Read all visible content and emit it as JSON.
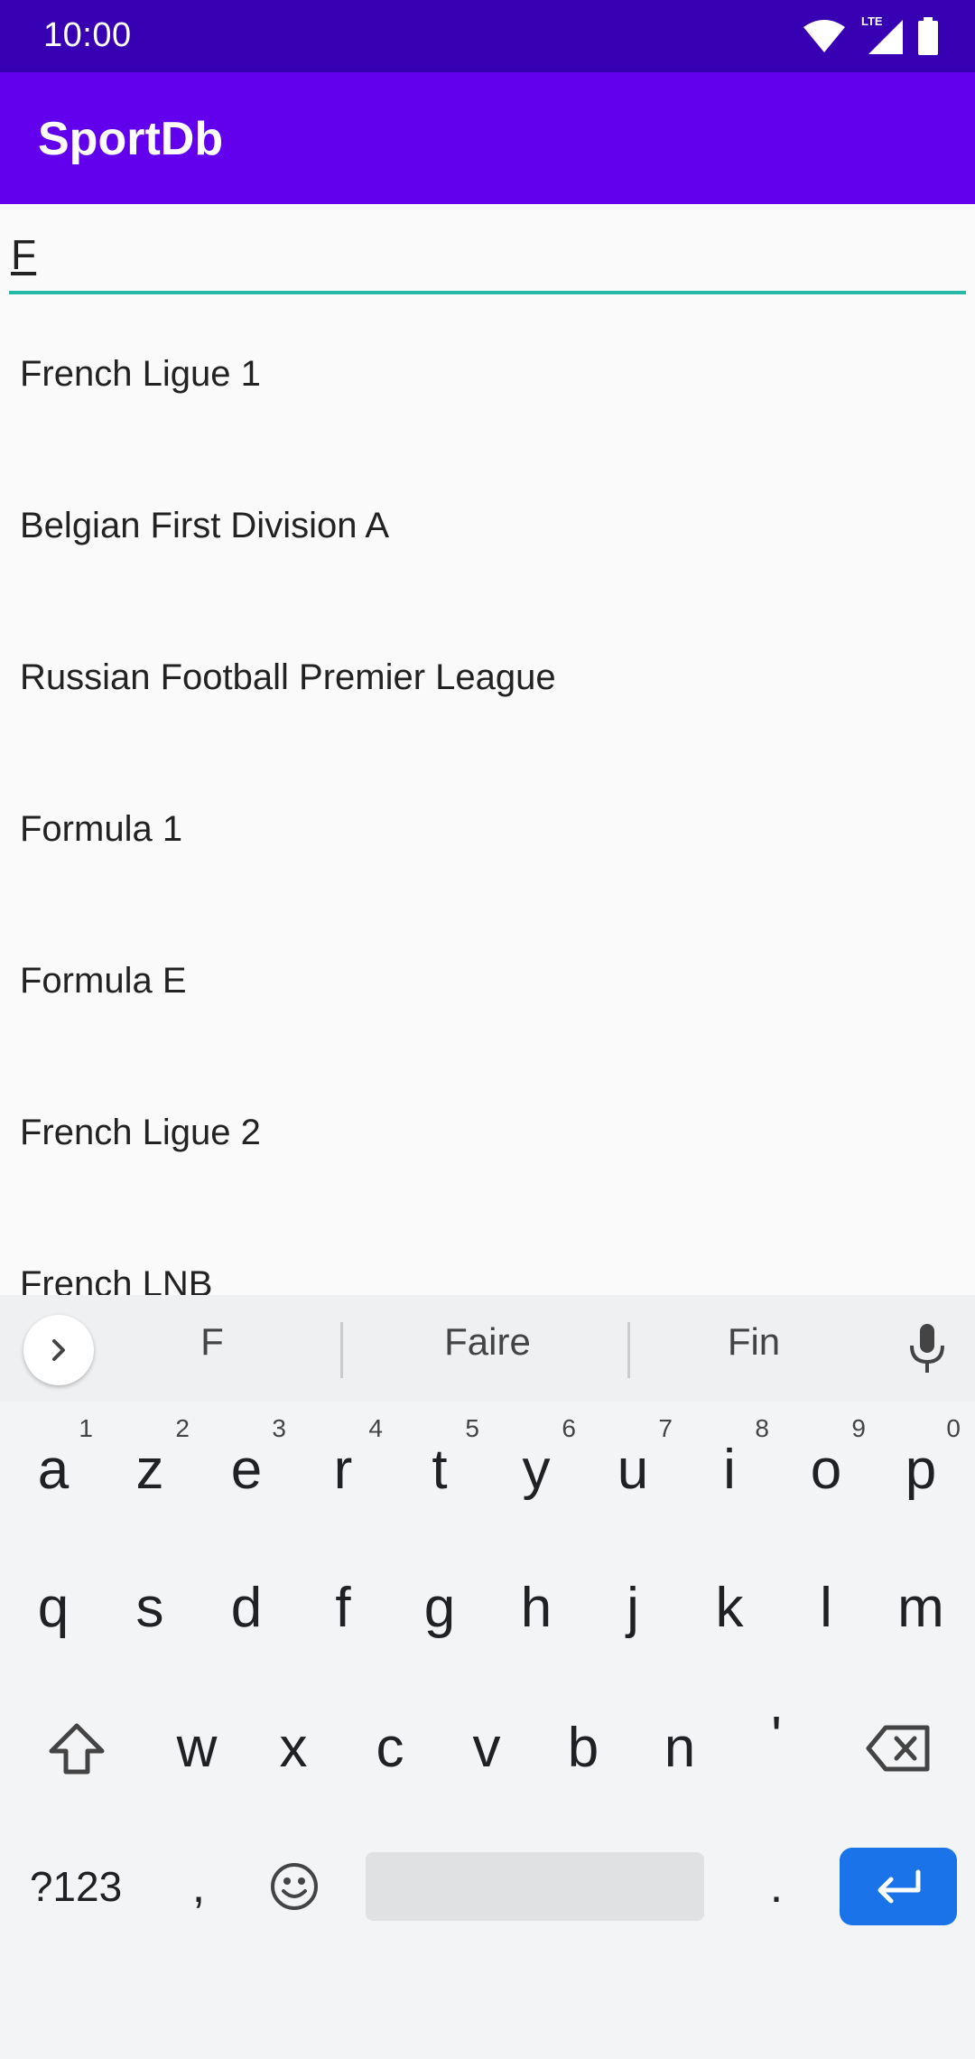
{
  "status_bar": {
    "time": "10:00",
    "network_label": "LTE"
  },
  "app_bar": {
    "title": "SportDb"
  },
  "search": {
    "value": "F"
  },
  "leagues": [
    "French Ligue 1",
    "Belgian First Division A",
    "Russian Football Premier League",
    "Formula 1",
    "Formula E",
    "French Ligue 2",
    "French LNB"
  ],
  "keyboard": {
    "suggestions": [
      "F",
      "Faire",
      "Fin"
    ],
    "row1": [
      {
        "key": "a",
        "hint": "1"
      },
      {
        "key": "z",
        "hint": "2"
      },
      {
        "key": "e",
        "hint": "3"
      },
      {
        "key": "r",
        "hint": "4"
      },
      {
        "key": "t",
        "hint": "5"
      },
      {
        "key": "y",
        "hint": "6"
      },
      {
        "key": "u",
        "hint": "7"
      },
      {
        "key": "i",
        "hint": "8"
      },
      {
        "key": "o",
        "hint": "9"
      },
      {
        "key": "p",
        "hint": "0"
      }
    ],
    "row2": [
      "q",
      "s",
      "d",
      "f",
      "g",
      "h",
      "j",
      "k",
      "l",
      "m"
    ],
    "row3": [
      "w",
      "x",
      "c",
      "v",
      "b",
      "n",
      "'"
    ],
    "symbols_label": "?123",
    "comma": ",",
    "period": "."
  },
  "colors": {
    "status_bar": "#3700b3",
    "app_bar": "#6200ee",
    "search_underline": "#26b9a8",
    "enter_key": "#1a73e8"
  }
}
